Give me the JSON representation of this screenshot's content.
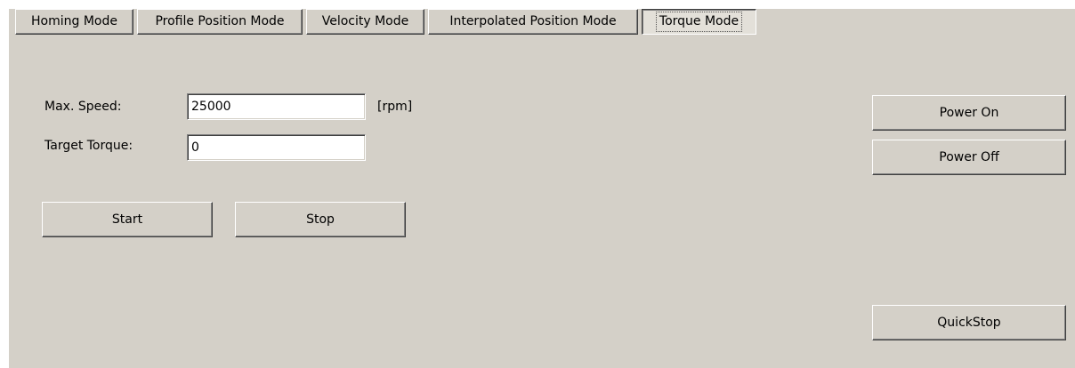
{
  "tabs": [
    {
      "label": "Homing Mode",
      "active": false
    },
    {
      "label": "Profile Position Mode",
      "active": false
    },
    {
      "label": "Velocity Mode",
      "active": false
    },
    {
      "label": "Interpolated Position Mode",
      "active": false
    },
    {
      "label": "Torque Mode",
      "active": true
    }
  ],
  "torque_mode": {
    "max_speed": {
      "label": "Max. Speed:",
      "value": "25000",
      "unit": "[rpm]"
    },
    "target_torque": {
      "label": "Target Torque:",
      "value": "0"
    },
    "start_label": "Start",
    "stop_label": "Stop"
  },
  "power": {
    "on_label": "Power On",
    "off_label": "Power Off",
    "quickstop_label": "QuickStop"
  },
  "colors": {
    "window_background": "#d4d0c8",
    "field_background": "#ffffff"
  }
}
